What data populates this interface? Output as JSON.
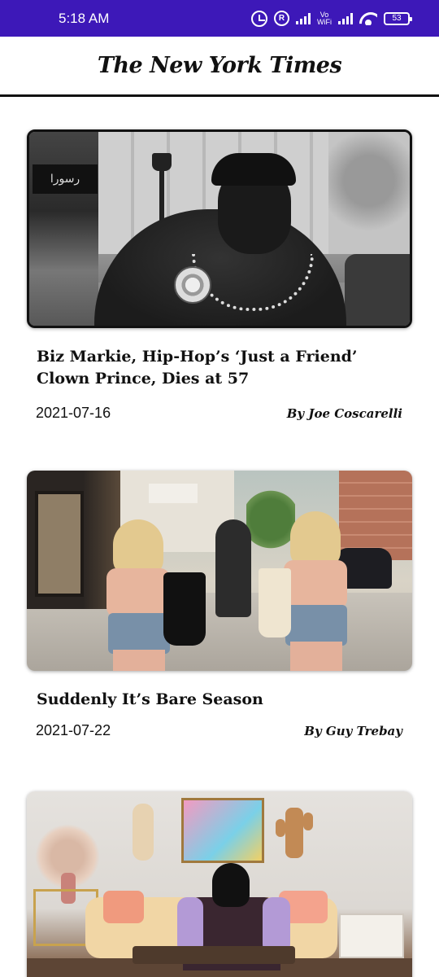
{
  "status_bar": {
    "time": "5:18 AM",
    "r_badge": "R",
    "vowifi_top": "Vo",
    "vowifi_bottom": "WiFi",
    "battery": "53",
    "icons": [
      "alarm-icon",
      "r-circle-icon",
      "signal-icon",
      "vowifi-icon",
      "signal-icon",
      "wifi-icon",
      "battery-icon"
    ]
  },
  "header": {
    "title": "The New York Times"
  },
  "articles": [
    {
      "headline": "Biz Markie, Hip-Hop’s ‘Just a Friend’ Clown Prince, Dies at 57",
      "date": "2021-07-16",
      "byline": "By Joe Coscarelli"
    },
    {
      "headline": "Suddenly It’s Bare Season",
      "date": "2021-07-22",
      "byline": "By Guy Trebay"
    },
    {
      "headline": "",
      "date": "",
      "byline": ""
    }
  ],
  "colors": {
    "status_bar": "#3d18b8",
    "text": "#111111",
    "background": "#ffffff"
  }
}
